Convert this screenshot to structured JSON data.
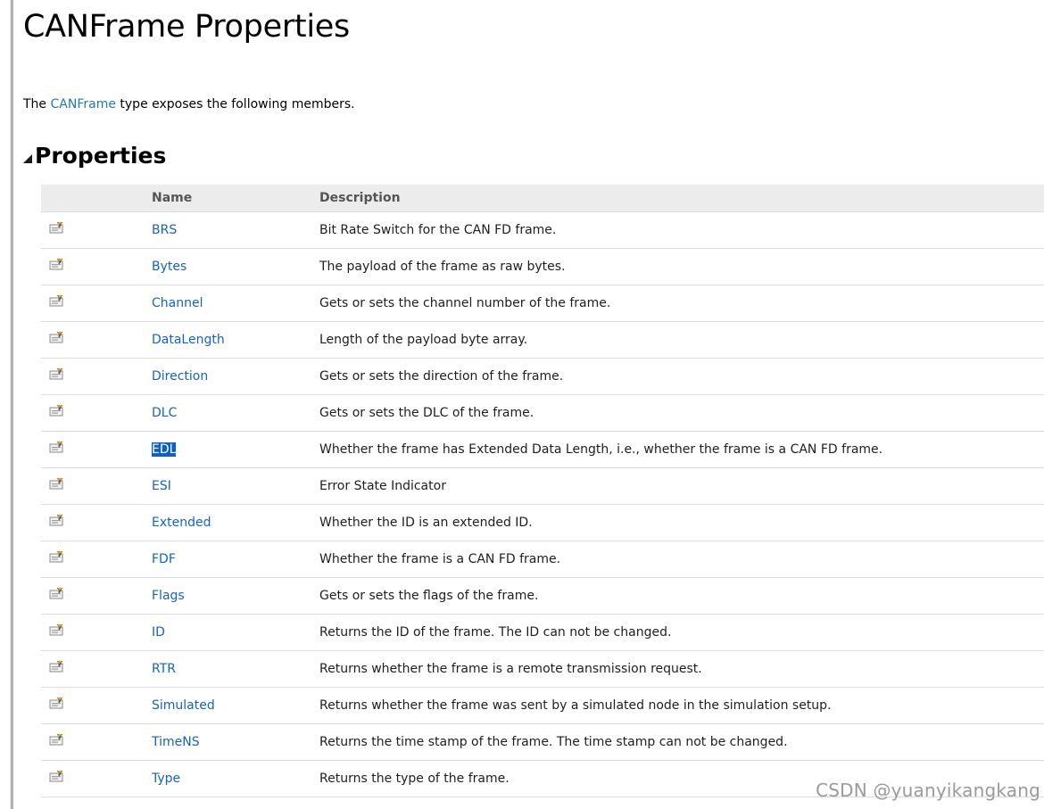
{
  "page": {
    "title": "CANFrame Properties",
    "intro": {
      "prefix": "The ",
      "type_link": "CANFrame",
      "suffix": " type exposes the following members."
    }
  },
  "section": {
    "heading": "Properties",
    "toggle_icon": "collapse-triangle-icon"
  },
  "table": {
    "columns": {
      "icon": "",
      "name": "Name",
      "description": "Description"
    },
    "row_icon": "property-icon",
    "rows": [
      {
        "name": "BRS",
        "description": "Bit Rate Switch for the CAN FD frame."
      },
      {
        "name": "Bytes",
        "description": "The payload of the frame as raw bytes."
      },
      {
        "name": "Channel",
        "description": "Gets or sets the channel number of the frame."
      },
      {
        "name": "DataLength",
        "description": "Length of the payload byte array."
      },
      {
        "name": "Direction",
        "description": "Gets or sets the direction of the frame."
      },
      {
        "name": "DLC",
        "description": "Gets or sets the DLC of the frame."
      },
      {
        "name": "EDL",
        "description": "Whether the frame has Extended Data Length, i.e., whether the frame is a CAN FD frame.",
        "selected": true
      },
      {
        "name": "ESI",
        "description": "Error State Indicator"
      },
      {
        "name": "Extended",
        "description": "Whether the ID is an extended ID."
      },
      {
        "name": "FDF",
        "description": "Whether the frame is a CAN FD frame."
      },
      {
        "name": "Flags",
        "description": "Gets or sets the flags of the frame."
      },
      {
        "name": "ID",
        "description": "Returns the ID of the frame. The ID can not be changed."
      },
      {
        "name": "RTR",
        "description": "Returns whether the frame is a remote transmission request."
      },
      {
        "name": "Simulated",
        "description": "Returns whether the frame was sent by a simulated node in the simulation setup."
      },
      {
        "name": "TimeNS",
        "description": "Returns the time stamp of the frame. The time stamp can not be changed."
      },
      {
        "name": "Type",
        "description": "Returns the type of the frame."
      }
    ]
  },
  "watermark": "CSDN @yuanyikangkang",
  "colors": {
    "link": "#1364c4",
    "selection": "#0a60c4",
    "header_bg": "#ececec"
  }
}
